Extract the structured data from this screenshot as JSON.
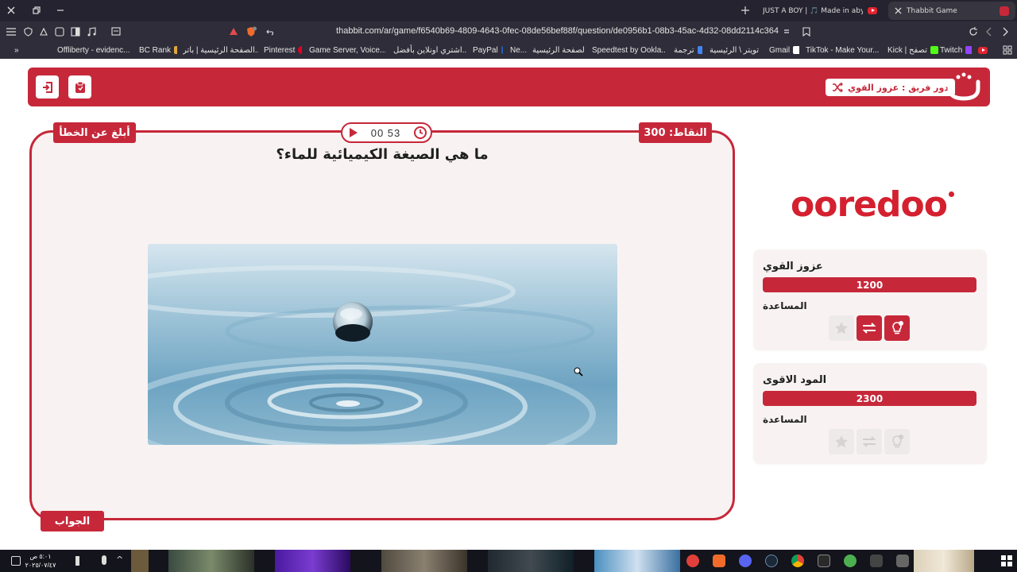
{
  "browser": {
    "tabs": [
      {
        "title": "JUST A BOY | 🎵 Made in abyss AMV",
        "active": false
      },
      {
        "title": "Thabbit Game",
        "active": true
      }
    ],
    "url": "thabbit.com/ar/game/f6540b69-4809-4643-0fec-08de56bef88f/question/de0956b1-08b3-45ac-4d32-08dd2114c364",
    "bookmarks": [
      "Offliberty - evidenc...",
      "BC Rank",
      "الصفحة الرئيسية | باتر...",
      "Pinterest",
      "Game Server, Voice...",
      "اشتري اونلاين بأفضل...",
      "PayPal",
      "Ne...",
      "الصفحة الرئيسية -",
      "Speedtest by Ookla...",
      "ترجمة",
      "تويتر \\ الرئيسية",
      "Gmail",
      "TikTok - Make Your...",
      "Kick | تصفح",
      "Twitch"
    ]
  },
  "header": {
    "team_turn": "دور فريق : عزوز القوي",
    "logo_letter": "ث"
  },
  "question": {
    "report_label": "أبلغ عن الخطأ",
    "points_label": "النقاط: 300",
    "timer": "00 53",
    "text": "ما هي الصيغة الكيميائية للماء؟",
    "answer_label": "الجواب"
  },
  "sponsor": {
    "name": "ooredoo"
  },
  "teams": [
    {
      "name": "عزوز القوي",
      "score": "1200",
      "help_label": "المساعدة",
      "active": true
    },
    {
      "name": "المود الاقوى",
      "score": "2300",
      "help_label": "المساعدة",
      "active": false
    }
  ],
  "taskbar": {
    "clock_time": "٥:٠١ ص",
    "clock_date": "٢٠٢٥/٠٧/٤٧"
  },
  "colors": {
    "brand": "#c6283a",
    "panel": "#f8f3f2",
    "chrome": "#2f2d39"
  }
}
